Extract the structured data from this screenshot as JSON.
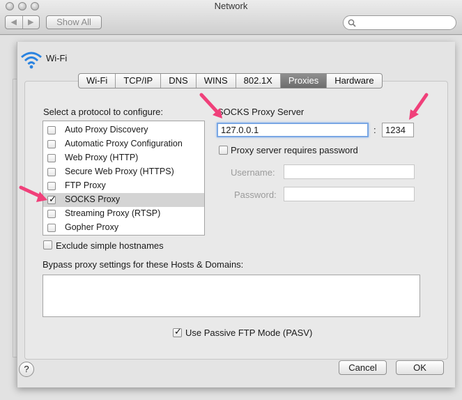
{
  "window": {
    "title": "Network"
  },
  "toolbar": {
    "back_glyph": "◀",
    "forward_glyph": "▶",
    "show_all_label": "Show All",
    "search_placeholder": ""
  },
  "header": {
    "service_label": "Wi-Fi",
    "service_icon": "wifi-icon"
  },
  "tabs": [
    {
      "label": "Wi-Fi",
      "active": false
    },
    {
      "label": "TCP/IP",
      "active": false
    },
    {
      "label": "DNS",
      "active": false
    },
    {
      "label": "WINS",
      "active": false
    },
    {
      "label": "802.1X",
      "active": false
    },
    {
      "label": "Proxies",
      "active": true
    },
    {
      "label": "Hardware",
      "active": false
    }
  ],
  "proxies": {
    "protocol_heading": "Select a protocol to configure:",
    "protocols": [
      {
        "label": "Auto Proxy Discovery",
        "checked": false,
        "selected": false
      },
      {
        "label": "Automatic Proxy Configuration",
        "checked": false,
        "selected": false
      },
      {
        "label": "Web Proxy (HTTP)",
        "checked": false,
        "selected": false
      },
      {
        "label": "Secure Web Proxy (HTTPS)",
        "checked": false,
        "selected": false
      },
      {
        "label": "FTP Proxy",
        "checked": false,
        "selected": false
      },
      {
        "label": "SOCKS Proxy",
        "checked": true,
        "selected": true
      },
      {
        "label": "Streaming Proxy (RTSP)",
        "checked": false,
        "selected": false
      },
      {
        "label": "Gopher Proxy",
        "checked": false,
        "selected": false
      }
    ],
    "server_heading": "SOCKS Proxy Server",
    "server_value": "127.0.0.1",
    "port_separator": ":",
    "port_value": "1234",
    "requires_password_label": "Proxy server requires password",
    "requires_password_checked": false,
    "username_label": "Username:",
    "username_value": "",
    "password_label": "Password:",
    "password_value": "",
    "exclude_simple_label": "Exclude simple hostnames",
    "exclude_simple_checked": false,
    "bypass_label": "Bypass proxy settings for these Hosts & Domains:",
    "bypass_value": "",
    "passive_ftp_label": "Use Passive FTP Mode (PASV)",
    "passive_ftp_checked": true
  },
  "footer": {
    "help_label": "?",
    "cancel_label": "Cancel",
    "ok_label": "OK"
  },
  "colors": {
    "annotation_arrow": "#f0407a",
    "active_tab": "#7a7a7a",
    "focus_ring": "#7aa7e4"
  }
}
